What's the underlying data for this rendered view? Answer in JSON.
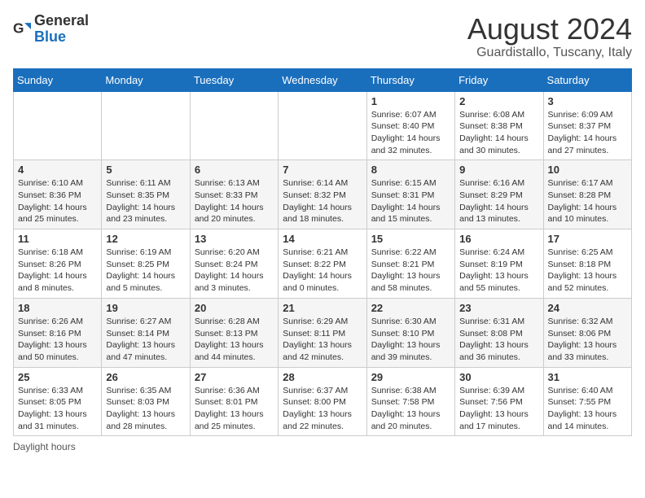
{
  "logo": {
    "text_general": "General",
    "text_blue": "Blue"
  },
  "title": "August 2024",
  "subtitle": "Guardistallo, Tuscany, Italy",
  "days_of_week": [
    "Sunday",
    "Monday",
    "Tuesday",
    "Wednesday",
    "Thursday",
    "Friday",
    "Saturday"
  ],
  "footer": "Daylight hours",
  "weeks": [
    [
      {
        "day": "",
        "info": ""
      },
      {
        "day": "",
        "info": ""
      },
      {
        "day": "",
        "info": ""
      },
      {
        "day": "",
        "info": ""
      },
      {
        "day": "1",
        "info": "Sunrise: 6:07 AM\nSunset: 8:40 PM\nDaylight: 14 hours and 32 minutes."
      },
      {
        "day": "2",
        "info": "Sunrise: 6:08 AM\nSunset: 8:38 PM\nDaylight: 14 hours and 30 minutes."
      },
      {
        "day": "3",
        "info": "Sunrise: 6:09 AM\nSunset: 8:37 PM\nDaylight: 14 hours and 27 minutes."
      }
    ],
    [
      {
        "day": "4",
        "info": "Sunrise: 6:10 AM\nSunset: 8:36 PM\nDaylight: 14 hours and 25 minutes."
      },
      {
        "day": "5",
        "info": "Sunrise: 6:11 AM\nSunset: 8:35 PM\nDaylight: 14 hours and 23 minutes."
      },
      {
        "day": "6",
        "info": "Sunrise: 6:13 AM\nSunset: 8:33 PM\nDaylight: 14 hours and 20 minutes."
      },
      {
        "day": "7",
        "info": "Sunrise: 6:14 AM\nSunset: 8:32 PM\nDaylight: 14 hours and 18 minutes."
      },
      {
        "day": "8",
        "info": "Sunrise: 6:15 AM\nSunset: 8:31 PM\nDaylight: 14 hours and 15 minutes."
      },
      {
        "day": "9",
        "info": "Sunrise: 6:16 AM\nSunset: 8:29 PM\nDaylight: 14 hours and 13 minutes."
      },
      {
        "day": "10",
        "info": "Sunrise: 6:17 AM\nSunset: 8:28 PM\nDaylight: 14 hours and 10 minutes."
      }
    ],
    [
      {
        "day": "11",
        "info": "Sunrise: 6:18 AM\nSunset: 8:26 PM\nDaylight: 14 hours and 8 minutes."
      },
      {
        "day": "12",
        "info": "Sunrise: 6:19 AM\nSunset: 8:25 PM\nDaylight: 14 hours and 5 minutes."
      },
      {
        "day": "13",
        "info": "Sunrise: 6:20 AM\nSunset: 8:24 PM\nDaylight: 14 hours and 3 minutes."
      },
      {
        "day": "14",
        "info": "Sunrise: 6:21 AM\nSunset: 8:22 PM\nDaylight: 14 hours and 0 minutes."
      },
      {
        "day": "15",
        "info": "Sunrise: 6:22 AM\nSunset: 8:21 PM\nDaylight: 13 hours and 58 minutes."
      },
      {
        "day": "16",
        "info": "Sunrise: 6:24 AM\nSunset: 8:19 PM\nDaylight: 13 hours and 55 minutes."
      },
      {
        "day": "17",
        "info": "Sunrise: 6:25 AM\nSunset: 8:18 PM\nDaylight: 13 hours and 52 minutes."
      }
    ],
    [
      {
        "day": "18",
        "info": "Sunrise: 6:26 AM\nSunset: 8:16 PM\nDaylight: 13 hours and 50 minutes."
      },
      {
        "day": "19",
        "info": "Sunrise: 6:27 AM\nSunset: 8:14 PM\nDaylight: 13 hours and 47 minutes."
      },
      {
        "day": "20",
        "info": "Sunrise: 6:28 AM\nSunset: 8:13 PM\nDaylight: 13 hours and 44 minutes."
      },
      {
        "day": "21",
        "info": "Sunrise: 6:29 AM\nSunset: 8:11 PM\nDaylight: 13 hours and 42 minutes."
      },
      {
        "day": "22",
        "info": "Sunrise: 6:30 AM\nSunset: 8:10 PM\nDaylight: 13 hours and 39 minutes."
      },
      {
        "day": "23",
        "info": "Sunrise: 6:31 AM\nSunset: 8:08 PM\nDaylight: 13 hours and 36 minutes."
      },
      {
        "day": "24",
        "info": "Sunrise: 6:32 AM\nSunset: 8:06 PM\nDaylight: 13 hours and 33 minutes."
      }
    ],
    [
      {
        "day": "25",
        "info": "Sunrise: 6:33 AM\nSunset: 8:05 PM\nDaylight: 13 hours and 31 minutes."
      },
      {
        "day": "26",
        "info": "Sunrise: 6:35 AM\nSunset: 8:03 PM\nDaylight: 13 hours and 28 minutes."
      },
      {
        "day": "27",
        "info": "Sunrise: 6:36 AM\nSunset: 8:01 PM\nDaylight: 13 hours and 25 minutes."
      },
      {
        "day": "28",
        "info": "Sunrise: 6:37 AM\nSunset: 8:00 PM\nDaylight: 13 hours and 22 minutes."
      },
      {
        "day": "29",
        "info": "Sunrise: 6:38 AM\nSunset: 7:58 PM\nDaylight: 13 hours and 20 minutes."
      },
      {
        "day": "30",
        "info": "Sunrise: 6:39 AM\nSunset: 7:56 PM\nDaylight: 13 hours and 17 minutes."
      },
      {
        "day": "31",
        "info": "Sunrise: 6:40 AM\nSunset: 7:55 PM\nDaylight: 13 hours and 14 minutes."
      }
    ]
  ]
}
